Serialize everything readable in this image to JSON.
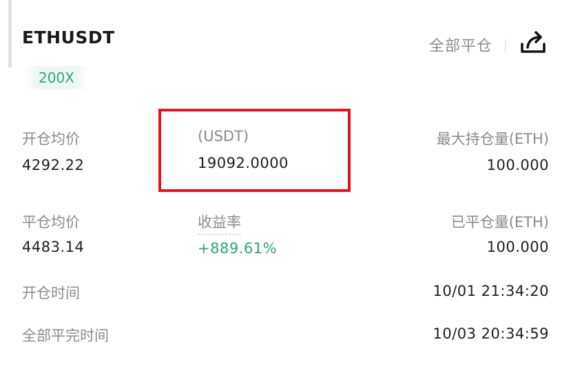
{
  "header": {
    "symbol": "ETHUSDT",
    "leverage": "200X",
    "close_all_label": "全部平仓",
    "share_icon": "share-icon"
  },
  "stats": {
    "open_avg_price_label": "开仓均价",
    "open_avg_price_value": "4292.22",
    "pnl_label": "(USDT)",
    "pnl_value": "19092.0000",
    "max_position_label": "最大持仓量(ETH)",
    "max_position_value": "100.000",
    "close_avg_price_label": "平仓均价",
    "close_avg_price_value": "4483.14",
    "roi_label": "收益率",
    "roi_value": "+889.61%",
    "closed_qty_label": "已平仓量(ETH)",
    "closed_qty_value": "100.000",
    "open_time_label": "开仓时间",
    "open_time_value": "10/01 21:34:20",
    "full_close_time_label": "全部平完时间",
    "full_close_time_value": "10/03 20:34:59"
  },
  "colors": {
    "positive": "#2ea37d",
    "highlight_border": "#e0141e",
    "label": "#8a8a8a",
    "text": "#1e1e1e"
  }
}
